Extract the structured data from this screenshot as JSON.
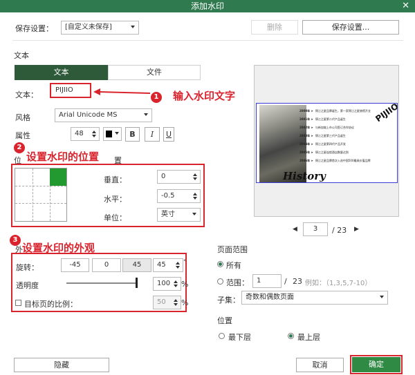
{
  "window": {
    "title": "添加水印",
    "close_glyph": "✕"
  },
  "save_settings": {
    "label": "保存设置：",
    "selected": "[自定义未保存]",
    "delete_label": "删除",
    "save_button_label": "保存设置..."
  },
  "section_text": {
    "title": "文本",
    "tab_text": "文本",
    "tab_file": "文件"
  },
  "text_field": {
    "label": "文本：",
    "value": "PIJIIO"
  },
  "style_field": {
    "label": "风格",
    "value": "Arial Unicode MS"
  },
  "attr_field": {
    "label": "属性",
    "size": "48",
    "bold": "B",
    "italic": "I",
    "underline": "U",
    "color": "#000000"
  },
  "position_section": {
    "title_partial": "位",
    "title_partial2": "置"
  },
  "position": {
    "vertical_label": "垂直：",
    "vertical_value": "0",
    "horizontal_label": "水平：",
    "horizontal_value": "-0.5",
    "unit_label": "单位：",
    "unit_value": "英寸"
  },
  "appearance_section": {
    "title_partial": "外"
  },
  "appearance": {
    "rotation_label": "旋转：",
    "rot_neg45": "-45",
    "rot_0": "0",
    "rot_45": "45",
    "rot_value": "45",
    "degree": "°",
    "opacity_label": "透明度",
    "opacity_value": "100",
    "percent": "%",
    "scale_label": "目标页的比例：",
    "scale_value": "50",
    "percent2": "%"
  },
  "annotations": {
    "a1_num": "1",
    "a1_text": "输入水印文字",
    "a2_num": "2",
    "a2_text": "设置水印的位置",
    "a3_num": "3",
    "a3_text": "设置水印的外观"
  },
  "preview": {
    "watermark": "PIJIIO",
    "history_word": "History",
    "years": [
      "2000年",
      "2001年",
      "2002年",
      "2003年",
      "2004年",
      "2005年",
      "2006年"
    ],
    "lines": [
      "锦江之星品牌诞生，第一家锦江之星旅馆开业",
      "锦江之星第二代产品诞生",
      "与新加坡上市公司签订合作协议",
      "锦江之星第三代产品诞生",
      "锦江之星第四代产品开发",
      "锦江之星连锁酒店数量达到",
      "锦江之星品牌首次入选中国500最具价值品牌"
    ],
    "page_current": "3",
    "page_total": "/ 23",
    "prev_glyph": "◀",
    "next_glyph": "▶"
  },
  "page_range": {
    "title": "页面范围",
    "all_label": "所有",
    "range_label": "范围：",
    "range_from": "1",
    "range_sep": "/",
    "range_total": "23",
    "example": "例如：（1,3,5,7-10）",
    "subset_label": "子集：",
    "subset_value": "奇数和偶数页面"
  },
  "layer": {
    "title": "位置",
    "bottom_label": "最下层",
    "top_label": "最上层"
  },
  "footer": {
    "hide_label": "隐藏",
    "cancel_label": "取消",
    "ok_label": "确定"
  }
}
